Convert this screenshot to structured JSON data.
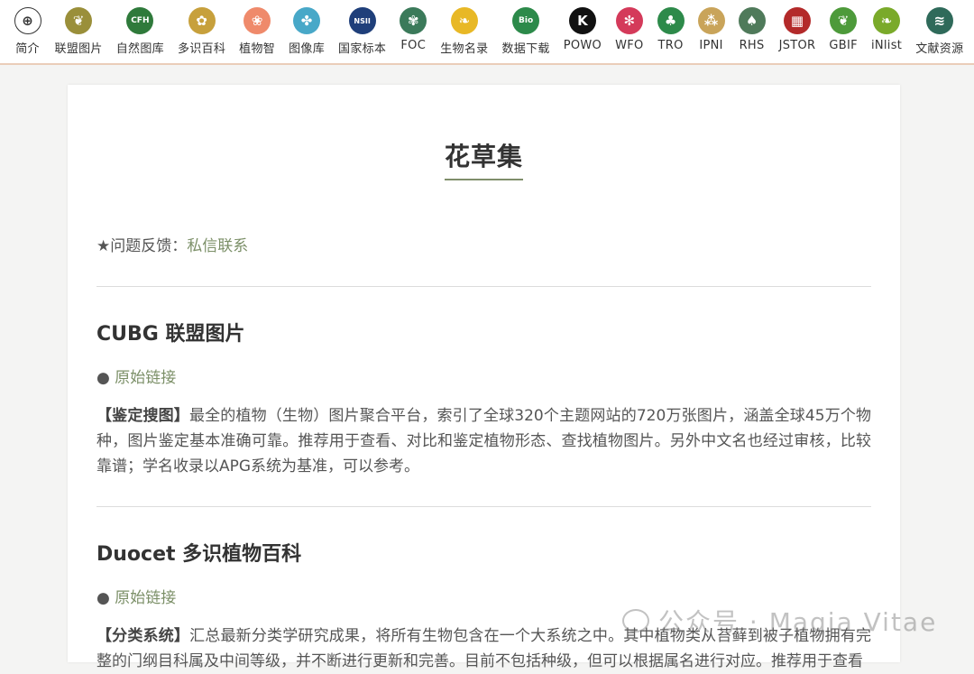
{
  "nav": {
    "items": [
      {
        "key": "intro",
        "label": "简介",
        "icon": "globe-icon",
        "color": "#ffffff",
        "glyph": "⊕"
      },
      {
        "key": "union",
        "label": "联盟图片",
        "icon": "plant-logo-icon",
        "color": "#9a8f3a",
        "glyph": "❦"
      },
      {
        "key": "cfh",
        "label": "自然图库",
        "icon": "cfh-logo-icon",
        "color": "#2f7a3b",
        "glyph": "CFH"
      },
      {
        "key": "duocet",
        "label": "多识百科",
        "icon": "tree-logo-icon",
        "color": "#c7a03c",
        "glyph": "✿"
      },
      {
        "key": "zhiwuzhi",
        "label": "植物智",
        "icon": "lotus-logo-icon",
        "color": "#ef8a6b",
        "glyph": "❀"
      },
      {
        "key": "ppbc",
        "label": "图像库",
        "icon": "pinwheel-logo-icon",
        "color": "#48a8c8",
        "glyph": "✤"
      },
      {
        "key": "nsii",
        "label": "国家标本",
        "icon": "nsii-logo-icon",
        "color": "#1f3f7a",
        "glyph": "NSII"
      },
      {
        "key": "foc",
        "label": "FOC",
        "icon": "foc-logo-icon",
        "color": "#3b7a5a",
        "glyph": "✾"
      },
      {
        "key": "species",
        "label": "生物名录",
        "icon": "ginkgo-logo-icon",
        "color": "#e8b826",
        "glyph": "❧"
      },
      {
        "key": "bionet",
        "label": "数据下载",
        "icon": "bionet-logo-icon",
        "color": "#2c8a4a",
        "glyph": "Bio"
      },
      {
        "key": "powo",
        "label": "POWO",
        "icon": "powo-logo-icon",
        "color": "#111111",
        "glyph": "K"
      },
      {
        "key": "wfo",
        "label": "WFO",
        "icon": "wfo-logo-icon",
        "color": "#d43a5a",
        "glyph": "✻"
      },
      {
        "key": "tro",
        "label": "TRO",
        "icon": "tro-logo-icon",
        "color": "#2d8a4a",
        "glyph": "♣"
      },
      {
        "key": "ipni",
        "label": "IPNI",
        "icon": "ipni-logo-icon",
        "color": "#c9a45a",
        "glyph": "⁂"
      },
      {
        "key": "rhs",
        "label": "RHS",
        "icon": "rhs-logo-icon",
        "color": "#4f7a5a",
        "glyph": "♠"
      },
      {
        "key": "jstor",
        "label": "JSTOR",
        "icon": "jstor-logo-icon",
        "color": "#b32a2a",
        "glyph": "▦"
      },
      {
        "key": "gbif",
        "label": "GBIF",
        "icon": "gbif-logo-icon",
        "color": "#4d9a3a",
        "glyph": "❦"
      },
      {
        "key": "inlist",
        "label": "iNlist",
        "icon": "inlist-logo-icon",
        "color": "#7aaa2a",
        "glyph": "❧"
      },
      {
        "key": "docs",
        "label": "文献资源",
        "icon": "books-logo-icon",
        "color": "#2f6a5a",
        "glyph": "≋"
      }
    ]
  },
  "page": {
    "title": "花草集",
    "feedback_prefix": "★问题反馈：",
    "feedback_link": "私信联系"
  },
  "sections": [
    {
      "title": "CUBG 联盟图片",
      "link_bullet": "●",
      "link_label": "原始链接",
      "tag": "【鉴定搜图】",
      "body": "最全的植物（生物）图片聚合平台，索引了全球320个主题网站的720万张图片，涵盖全球45万个物种，图片鉴定基本准确可靠。推荐用于查看、对比和鉴定植物形态、查找植物图片。另外中文名也经过审核，比较靠谱；学名收录以APG系统为基准，可以参考。"
    },
    {
      "title": "Duocet 多识植物百科",
      "link_bullet": "●",
      "link_label": "原始链接",
      "tag": "【分类系统】",
      "body": "汇总最新分类学研究成果，将所有生物包含在一个大系统之中。其中植物类从苔藓到被子植物拥有完整的门纲目科属及中间等级，并不断进行更新和完善。目前不包括种级，但可以根据属名进行对应。推荐用于查看"
    }
  ],
  "watermark": {
    "text": "公众号 · Magia Vitae"
  }
}
